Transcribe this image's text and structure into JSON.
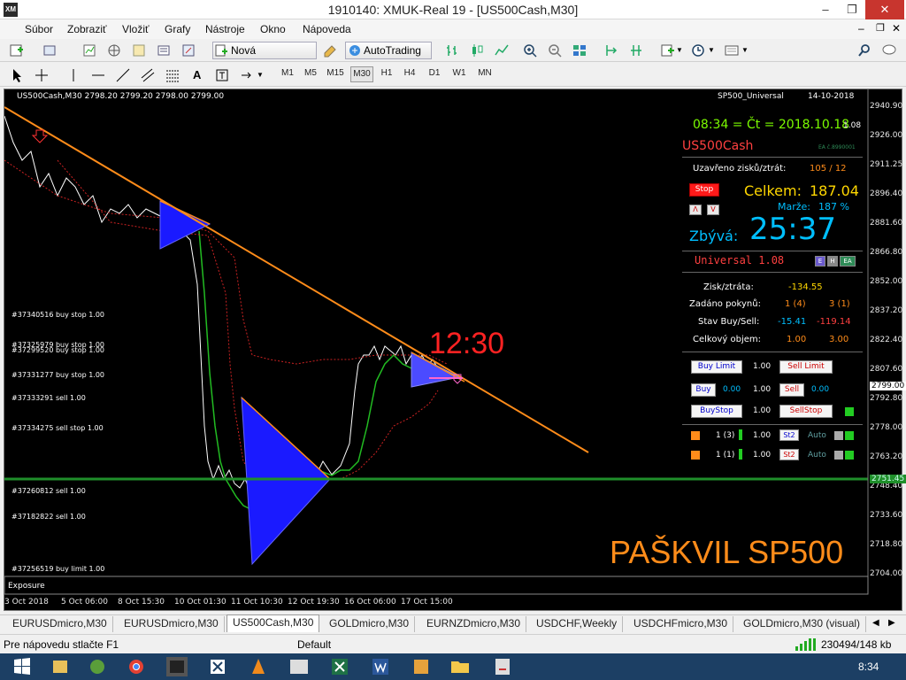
{
  "window": {
    "title": "1910140: XMUK-Real 19 - [US500Cash,M30]",
    "app_logo": "XM"
  },
  "menu": [
    "Súbor",
    "Zobraziť",
    "Vložiť",
    "Grafy",
    "Nástroje",
    "Okno",
    "Nápoveda"
  ],
  "toolbar": {
    "new_order": "Nová objednávka",
    "autotrading": "AutoTrading"
  },
  "timeframes": [
    "M1",
    "M5",
    "M15",
    "M30",
    "H1",
    "H4",
    "D1",
    "W1",
    "MN"
  ],
  "selected_timeframe": "M30",
  "chart": {
    "header": "US500Cash,M30  2798.20 2799.20 2798.00 2799.00",
    "indicator_name": "SP500_Universal",
    "indicator_date": "14-10-2018",
    "price_labels": [
      "2940.90",
      "2926.00",
      "2911.25",
      "2896.40",
      "2881.60",
      "2866.80",
      "2852.00",
      "2837.20",
      "2822.40",
      "2807.60",
      "2792.80",
      "2778.00",
      "2763.20",
      "2748.40",
      "2733.60",
      "2718.80",
      "2704.00"
    ],
    "current_price": "2799.00",
    "line_price": "2751.45",
    "date_labels": [
      "3 Oct 2018",
      "5 Oct 06:00",
      "8 Oct 15:30",
      "10 Oct 01:30",
      "11 Oct 10:30",
      "12 Oct 19:30",
      "16 Oct 06:00",
      "17 Oct 15:00"
    ],
    "order_labels": [
      "#37340516 buy stop 1.00",
      "#37325979 buy stop 1.00",
      "#37299520 buy stop 1.00",
      "#37331277 buy stop 1.00",
      "#37333291 sell 1.00",
      "#37334275 sell stop 1.00",
      "#37260812 sell 1.00",
      "#37182822 sell 1.00",
      "#37256519 buy limit 1.00"
    ],
    "time_marker": "12:30",
    "watermark": "PAŠKVIL SP500",
    "exposure_tab": "Exposure"
  },
  "panel": {
    "time": "08:34 = Čt = 2018.10.18",
    "version": "1.08",
    "symbol": "US500Cash",
    "ea_id": "EA č.8990001",
    "closed_label": "Uzavřeno zisků/ztrát:",
    "closed_value": "105 / 12",
    "stop_btn": "Stop",
    "total_label": "Celkem:",
    "total_value": "187.04",
    "margin_label": "Marže:",
    "margin_value": "187 %",
    "a_btn": "Λ",
    "v_btn": "V",
    "remaining_label": "Zbývá:",
    "remaining_value": "25:37",
    "universal": "Universal 1.08",
    "badge_e": "E",
    "badge_h": "H",
    "badge_ea": "EA",
    "pl_label": "Zisk/ztráta:",
    "pl_value": "-134.55",
    "orders_label": "Zadáno pokynů:",
    "orders_buy": "1 (4)",
    "orders_sell": "3 (1)",
    "state_label": "Stav Buy/Sell:",
    "state_buy": "-15.41",
    "state_sell": "-119.14",
    "volume_label": "Celkový objem:",
    "volume_buy": "1.00",
    "volume_sell": "3.00",
    "buy_limit": "Buy Limit",
    "sell_limit": "Sell Limit",
    "buy": "Buy",
    "sell": "Sell",
    "buystop": "BuyStop",
    "sellstop": "SellStop",
    "lot": "1.00",
    "buy_zero": "0.00",
    "sell_zero": "0.00",
    "row1_count": "1 (3)",
    "row2_count": "1 (1)",
    "st2": "St2",
    "auto": "Auto"
  },
  "tabs": [
    "3 Oct 2018",
    "EURUSDmicro,M30",
    "EURUSDmicro,M30",
    "US500Cash,M30",
    "GOLDmicro,M30",
    "EURNZDmicro,M30",
    "USDCHF,Weekly",
    "USDCHFmicro,M30",
    "GOLDmicro,M30 (visual)"
  ],
  "active_tab": "US500Cash,M30",
  "status": {
    "help": "Pre nápovedu stlačte F1",
    "profile": "Default",
    "traffic": "230494/148 kb"
  },
  "taskbar": {
    "clock": "8:34"
  },
  "colors": {
    "chart_bg": "#000000",
    "trendline": "#ff8c1a",
    "hline": "#1f8f2a",
    "triangle": "#1a1aff",
    "watermark": "#ff8c1a"
  }
}
